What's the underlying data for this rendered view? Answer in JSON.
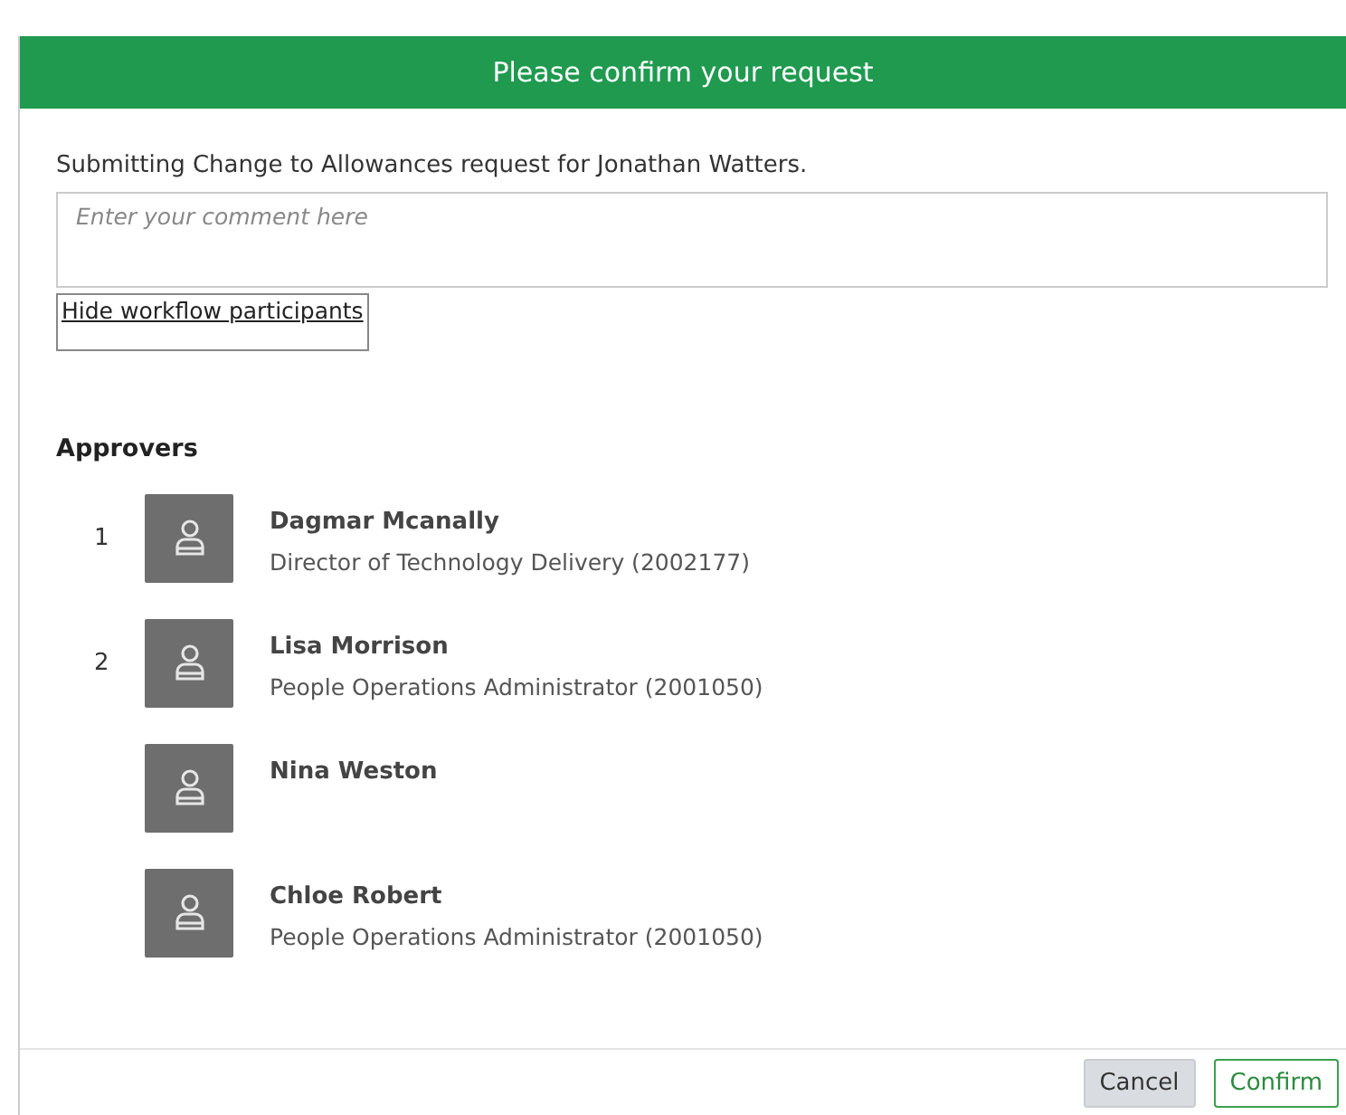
{
  "dialog": {
    "title": "Please confirm your request",
    "message": "Submitting Change to Allowances request for Jonathan Watters.",
    "comment": {
      "placeholder": "Enter your comment here"
    },
    "toggle_link": "Hide workflow participants",
    "section_title": "Approvers",
    "approvers": [
      {
        "step": "1",
        "name": "Dagmar Mcanally",
        "role": "Director of Technology Delivery (2002177)"
      },
      {
        "step": "2",
        "name": "Lisa Morrison",
        "role": "People Operations Administrator (2001050)"
      },
      {
        "name": "Nina Weston"
      },
      {
        "name": "Chloe Robert",
        "role": "People Operations Administrator (2001050)"
      }
    ],
    "buttons": [
      {
        "label": "Cancel",
        "kind": "secondary"
      },
      {
        "label": "Confirm",
        "kind": "primary"
      }
    ]
  }
}
